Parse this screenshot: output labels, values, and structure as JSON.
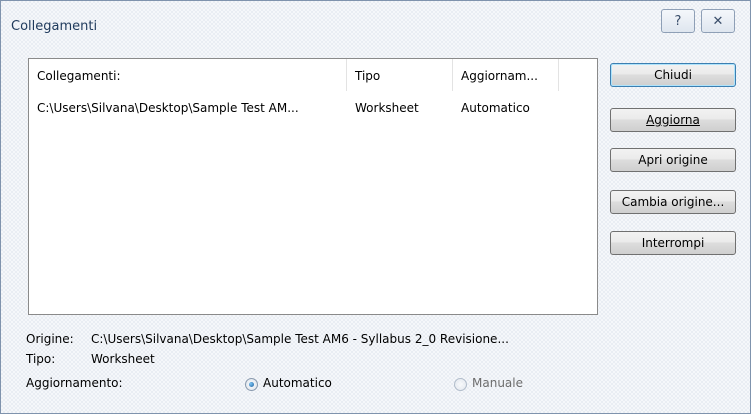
{
  "window": {
    "title": "Collegamenti"
  },
  "titlebar": {
    "help_glyph": "?",
    "close_glyph": "✕"
  },
  "list": {
    "columns": [
      "Collegamenti:",
      "Tipo",
      "Aggiornam..."
    ],
    "rows": [
      {
        "source": "C:\\Users\\Silvana\\Desktop\\Sample Test AM...",
        "type": "Worksheet",
        "update": "Automatico"
      }
    ]
  },
  "buttons": {
    "close": "Chiudi",
    "update_now": "Aggiorna",
    "open_source": "Apri origine",
    "change_source": "Cambia origine...",
    "break_link": "Interrompi"
  },
  "details": {
    "origin_label": "Origine:",
    "origin_value": "C:\\Users\\Silvana\\Desktop\\Sample Test AM6 - Syllabus 2_0 Revisione...",
    "type_label": "Tipo:",
    "type_value": "Worksheet",
    "update_label": "Aggiornamento:",
    "automatic_label": "Automatico",
    "manual_label": "Manuale",
    "selected_mode": "Automatico"
  }
}
